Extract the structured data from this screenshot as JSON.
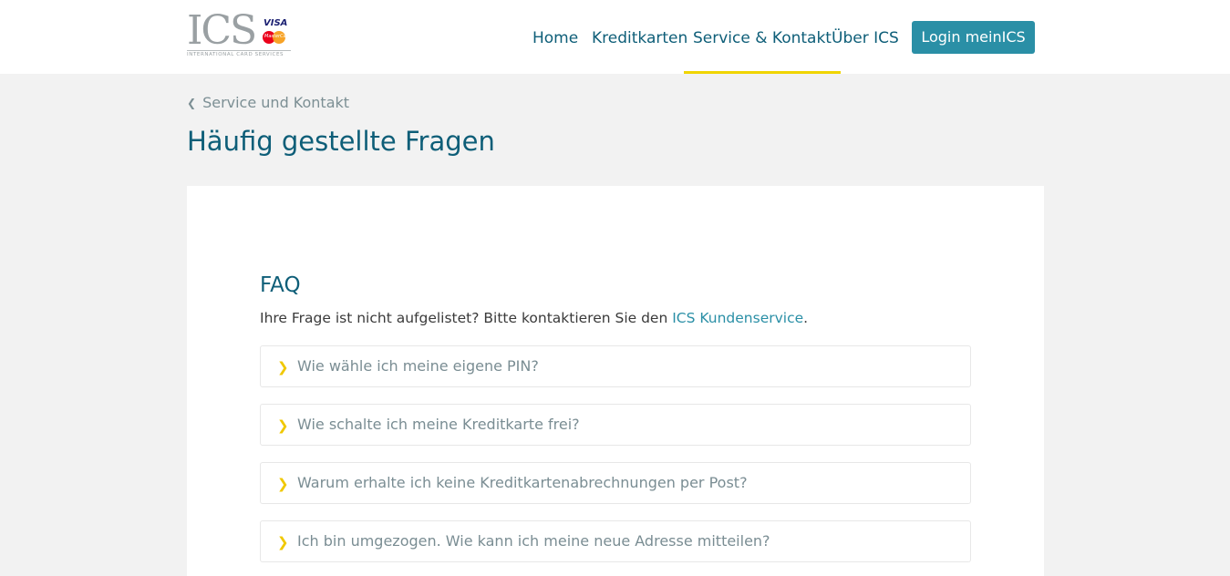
{
  "header": {
    "logo": {
      "text": "ICS",
      "tagline": "INTERNATIONAL CARD SERVICES",
      "visa": "VISA",
      "mastercard": "MasterCard"
    },
    "nav": [
      {
        "label": "Home"
      },
      {
        "label": "Kreditkarten"
      },
      {
        "label": "Service & Kontakt",
        "active": true
      },
      {
        "label": "Über ICS"
      }
    ],
    "login_label": "Login meinICS"
  },
  "breadcrumb": {
    "icon": "chevron-left-icon",
    "label": "Service und Kontakt"
  },
  "page_title": "Häufig gestellte Fragen",
  "faq": {
    "heading": "FAQ",
    "intro_text": "Ihre Frage ist nicht aufgelistet? Bitte kontaktieren Sie den ",
    "intro_link": "ICS Kundenservice",
    "intro_end": ".",
    "item_icon": "chevron-right-icon",
    "items": [
      {
        "question": "Wie wähle ich meine eigene PIN?"
      },
      {
        "question": "Wie schalte ich meine Kreditkarte frei?"
      },
      {
        "question": "Warum erhalte ich keine Kreditkartenabrechnungen per Post?"
      },
      {
        "question": "Ich bin umgezogen. Wie kann ich meine neue Adresse mitteilen?"
      }
    ]
  },
  "colors": {
    "brand_primary": "#0e5e78",
    "login_button": "#2a8fa6",
    "active_underline": "#f0d500",
    "chevron": "#f0c800",
    "page_background": "#f2f2f2"
  }
}
